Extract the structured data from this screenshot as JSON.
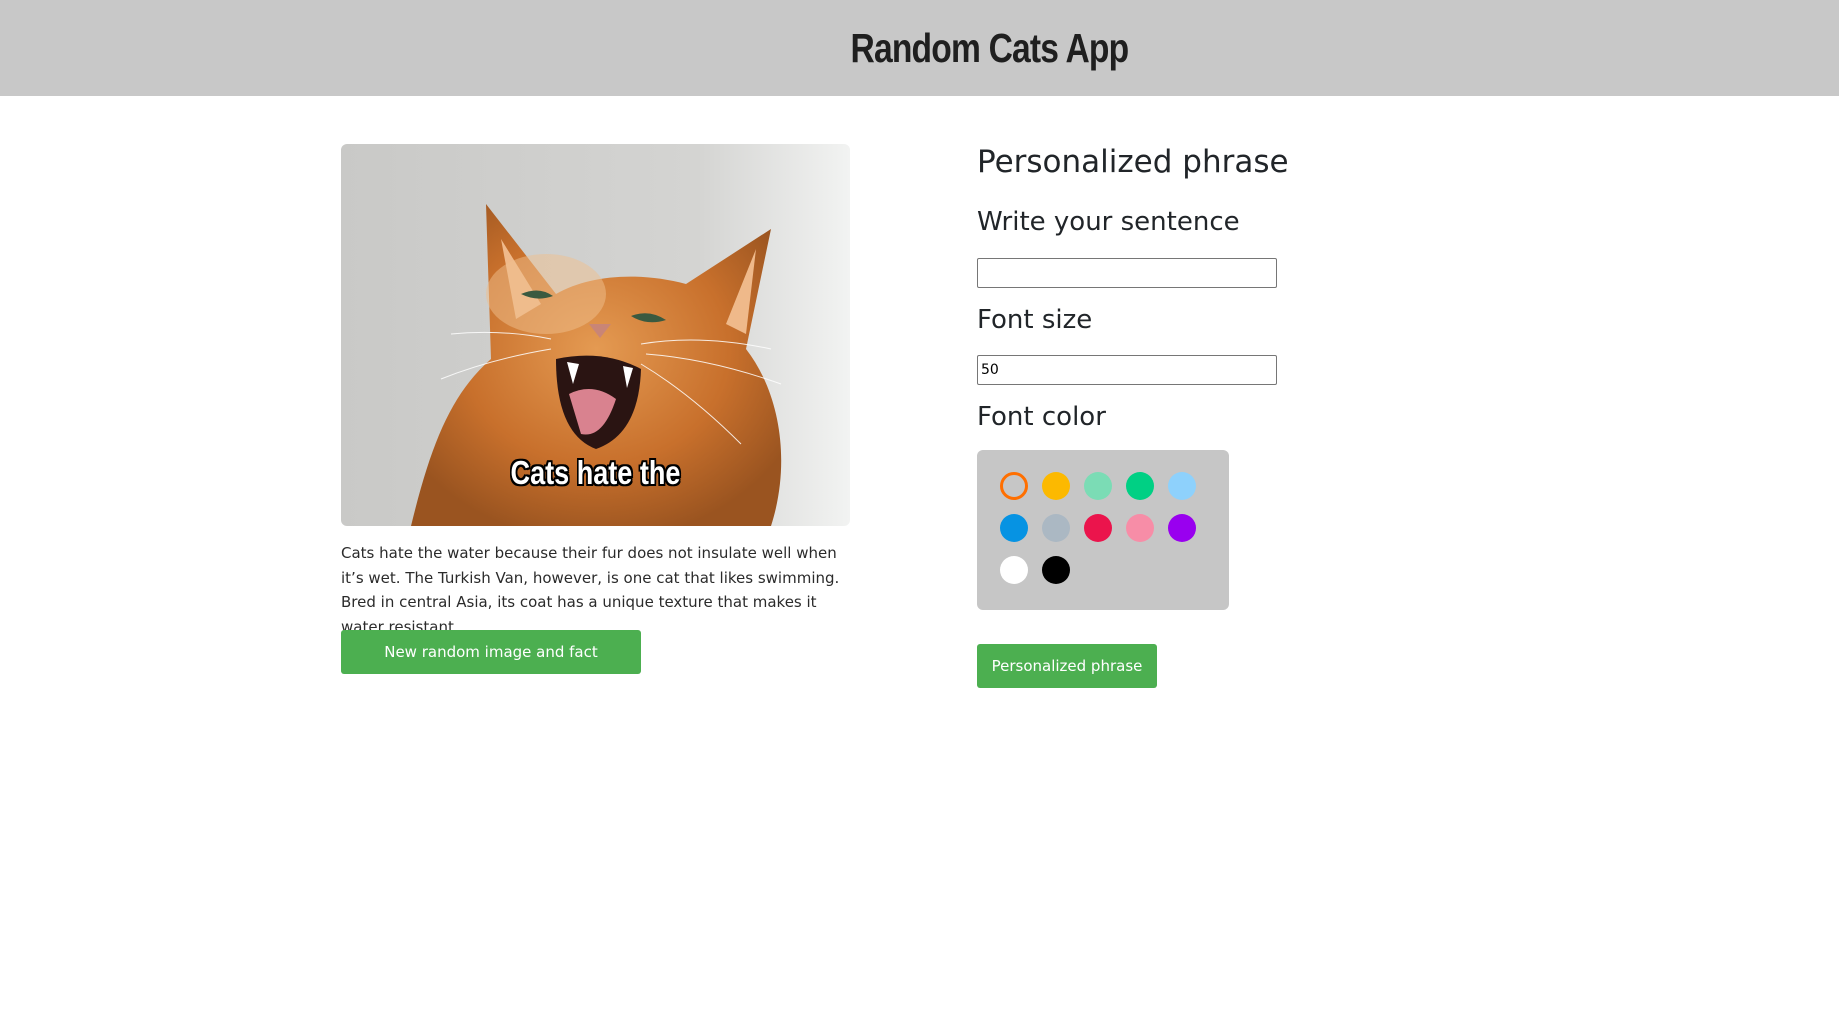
{
  "header": {
    "title": "Random Cats App"
  },
  "cat_card": {
    "meme_text": "Cats hate the",
    "fact": "Cats hate the water because their fur does not insulate well when it’s wet. The Turkish Van, however, is one cat that likes swimming. Bred in central Asia, its coat has a unique texture that makes it water resistant.",
    "new_button_label": "New random image and fact"
  },
  "form": {
    "title": "Personalized phrase",
    "sentence_label": "Write your sentence",
    "sentence_value": "",
    "font_size_label": "Font size",
    "font_size_value": "50",
    "font_color_label": "Font color",
    "colors": [
      "#ff6f00",
      "#fcb900",
      "#7bdcb5",
      "#00d084",
      "#8ed1fc",
      "#0693e3",
      "#abb8c3",
      "#eb144c",
      "#f78da7",
      "#9900ef",
      "#ffffff",
      "#000000"
    ],
    "selected_color": "#ff6f00",
    "submit_label": "Personalized phrase"
  }
}
